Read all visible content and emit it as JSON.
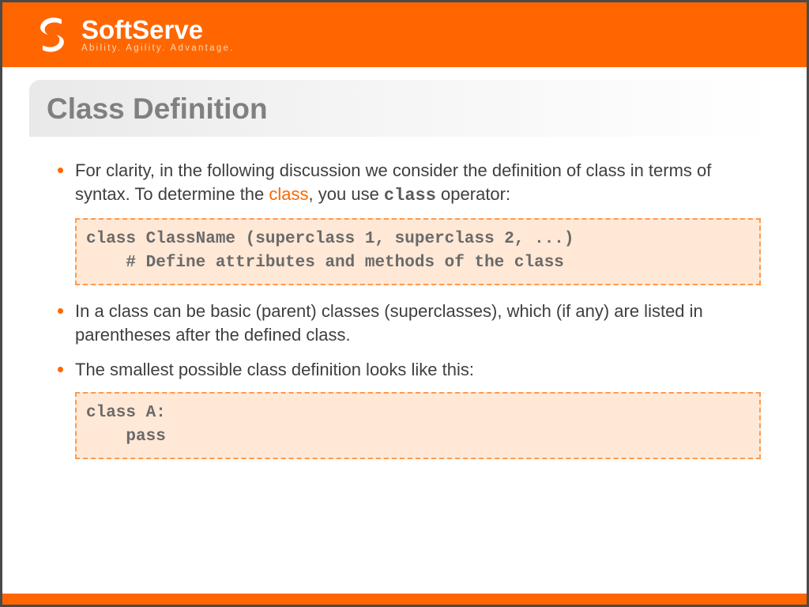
{
  "brand": {
    "name": "SoftServe",
    "tagline": "Ability. Agility. Advantage."
  },
  "slide": {
    "title": "Class Definition",
    "bullets": {
      "b1_pre": "For clarity, in the following discussion we consider the definition of class in terms of syntax. To determine the ",
      "b1_hl": "class",
      "b1_mid": ", you use ",
      "b1_mono": "class",
      "b1_post": " operator:",
      "b2": "In a class can be basic (parent) classes (superclasses), which (if any) are listed in parentheses after the defined class.",
      "b3": "The smallest possible class definition looks like this:"
    },
    "code": {
      "block1_line1": "class ClassName (superclass 1, superclass 2, ...)",
      "block1_line2": "    # Define attributes and methods of the class",
      "block2_line1": "class A:",
      "block2_line2": "    pass"
    }
  }
}
